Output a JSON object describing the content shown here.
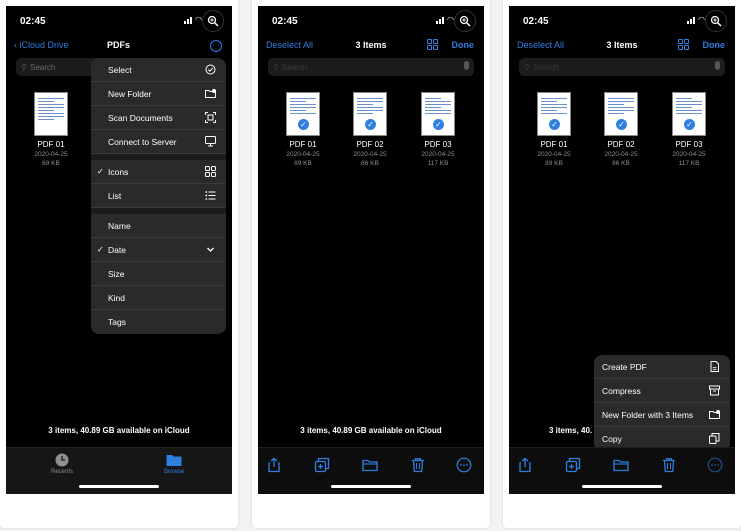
{
  "colors": {
    "accent": "#2f7fe0",
    "background": "#000000",
    "menu_bg": "#2a2a2c"
  },
  "status": {
    "time": "02:45"
  },
  "screen1": {
    "back_label": "iCloud Drive",
    "title": "PDFs",
    "search_placeholder": "Search",
    "file": {
      "name": "PDF 01",
      "date": "2020-04-25",
      "size": "89 KB"
    },
    "menu": {
      "group1": [
        {
          "label": "Select",
          "icon": "checkmark-circle-icon"
        },
        {
          "label": "New Folder",
          "icon": "folder-add-icon"
        },
        {
          "label": "Scan Documents",
          "icon": "scan-icon"
        },
        {
          "label": "Connect to Server",
          "icon": "server-icon"
        }
      ],
      "group2": [
        {
          "label": "Icons",
          "checked": "✓",
          "icon": "grid-icon"
        },
        {
          "label": "List",
          "icon": "list-icon"
        }
      ],
      "group3": [
        {
          "label": "Name"
        },
        {
          "label": "Date",
          "checked": "✓",
          "icon": "chevron-down-icon"
        },
        {
          "label": "Size"
        },
        {
          "label": "Kind"
        },
        {
          "label": "Tags"
        }
      ]
    },
    "storage": "3 items, 40.89 GB available on iCloud",
    "tabs": [
      {
        "label": "Recents",
        "icon": "clock-icon"
      },
      {
        "label": "Browse",
        "icon": "folder-icon"
      }
    ]
  },
  "screen2": {
    "deselect_label": "Deselect All",
    "title": "3 Items",
    "done_label": "Done",
    "search_placeholder": "Search",
    "files": [
      {
        "name": "PDF 01",
        "date": "2020-04-25",
        "size": "89 KB"
      },
      {
        "name": "PDF 02",
        "date": "2020-04-25",
        "size": "86 KB"
      },
      {
        "name": "PDF 03",
        "date": "2020-04-25",
        "size": "117 KB"
      }
    ],
    "storage": "3 items, 40.89 GB available on iCloud"
  },
  "screen3": {
    "deselect_label": "Deselect All",
    "title": "3 Items",
    "done_label": "Done",
    "search_placeholder": "Search",
    "files": [
      {
        "name": "PDF 01",
        "date": "2020-04-25",
        "size": "89 KB"
      },
      {
        "name": "PDF 02",
        "date": "2020-04-25",
        "size": "86 KB"
      },
      {
        "name": "PDF 03",
        "date": "2020-04-25",
        "size": "117 KB"
      }
    ],
    "storage_partial": "3 items, 40.",
    "menu": [
      {
        "label": "Create PDF",
        "icon": "document-icon"
      },
      {
        "label": "Compress",
        "icon": "archive-icon"
      },
      {
        "label": "New Folder with 3 Items",
        "icon": "folder-add-icon"
      },
      {
        "label": "Copy",
        "icon": "copy-icon"
      }
    ]
  }
}
